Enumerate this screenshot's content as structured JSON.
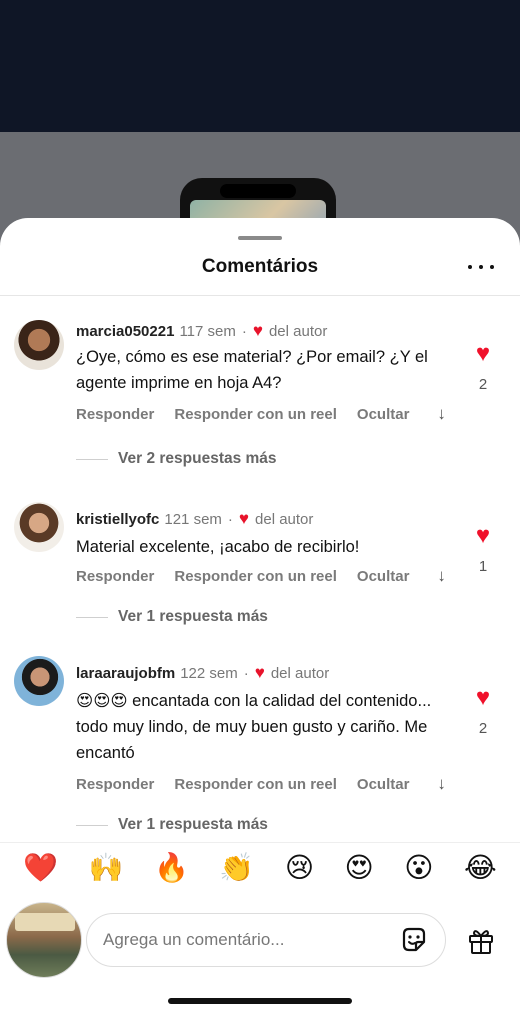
{
  "sheet": {
    "title": "Comentários"
  },
  "comments": [
    {
      "username": "marcia050221",
      "time": "117 sem",
      "author_badge": "del autor",
      "text": "¿Oye, cómo es ese material? ¿Por email? ¿Y el agente imprime en hoja A4?",
      "likes": "2",
      "reply_label": "Responder",
      "reel_label": "Responder con un reel",
      "hide_label": "Ocultar",
      "view_replies": "Ver 2 respuestas más"
    },
    {
      "username": "kristiellyofc",
      "time": "121 sem",
      "author_badge": "del autor",
      "text": "Material excelente, ¡acabo de recibirlo!",
      "likes": "1",
      "reply_label": "Responder",
      "reel_label": "Responder con un reel",
      "hide_label": "Ocultar",
      "view_replies": "Ver 1 respuesta más"
    },
    {
      "username": "laraaraujobfm",
      "time": "122 sem",
      "author_badge": "del autor",
      "text": "😍😍😍 encantada con la calidad del contenido... todo muy lindo, de muy buen gusto y cariño. Me encantó",
      "likes": "2",
      "reply_label": "Responder",
      "reel_label": "Responder con un reel",
      "hide_label": "Ocultar",
      "view_replies": "Ver 1 respuesta más"
    }
  ],
  "emoji_bar": [
    "❤️",
    "🙌",
    "🔥",
    "👏",
    "😢",
    "😍",
    "😮",
    "😂"
  ],
  "composer": {
    "placeholder": "Agrega un comentário..."
  },
  "colors": {
    "like_red": "#f0112b",
    "backdrop": "#0f1626"
  }
}
